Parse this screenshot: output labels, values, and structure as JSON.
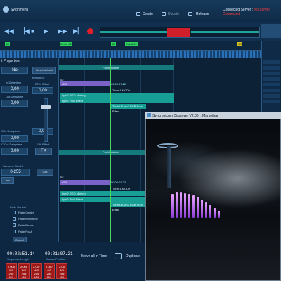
{
  "app": {
    "title": "Sytonmenu"
  },
  "menu": [
    {
      "label": "Create",
      "dim": false
    },
    {
      "label": "Update",
      "dim": true
    },
    {
      "label": "Release",
      "dim": false
    }
  ],
  "status": {
    "prefix": "Connected Server :",
    "value": "No Server Connected"
  },
  "ruler_markers": [
    {
      "label": "1B",
      "color": "green"
    },
    {
      "label": "Detail 22",
      "color": "green"
    },
    {
      "label": "1B",
      "color": "green"
    },
    {
      "label": "Detail 22",
      "color": "green"
    },
    {
      "label": "1B",
      "color": "yellow"
    }
  ],
  "left_panel": {
    "title": "t Properties",
    "no_value": "No",
    "reset_label": "Reset default",
    "fields": [
      {
        "label": "In Delaytime",
        "value": "0,00"
      },
      {
        "label": "Out Delaytime",
        "value": "0,00"
      },
      {
        "label": "C In Delaytime",
        "value": "0,00"
      },
      {
        "label": "C Out Delaytime",
        "value": "0,00"
      }
    ],
    "side_label": "eration ID",
    "bpm_label": "BPM Offset",
    "bpm_value": "0,00",
    "bpm_value2": "0,00",
    "edit_label": "Edit Effect",
    "fx_label": "FX",
    "scene_label": "Scene or Cuelist",
    "range_value": "0-255",
    "call_label": "Call",
    "less_label": "ess",
    "fade_title": "Fade Control",
    "fade_options": [
      "Fade Center",
      "Fade Amplitude",
      "Fade Phase",
      "Fade RyAlt"
    ],
    "cancel_label": "Cancel"
  },
  "timeline": {
    "tracks_a": [
      {
        "kind": "header",
        "label": "Fochfontaine"
      },
      {
        "kind": "label",
        "label": "02"
      },
      {
        "kind": "purple",
        "label": "r255",
        "time": "00:00:07.22"
      },
      {
        "kind": "label",
        "label": "Turm 1 MODe"
      },
      {
        "kind": "teal",
        "label": "Lym2 RGD Moving"
      },
      {
        "kind": "teal",
        "label": "Lym2 Pool Effect"
      },
      {
        "kind": "teal",
        "label": "Turm1&Lym2 RGB Burst Effect"
      }
    ],
    "tracks_b": [
      {
        "kind": "header",
        "label": "Fochfontaine"
      },
      {
        "kind": "label",
        "label": "02"
      },
      {
        "kind": "purple",
        "label": "r255",
        "time": "00:00:07.22"
      },
      {
        "kind": "label",
        "label": "Turm 1 MODe"
      },
      {
        "kind": "teal",
        "label": "Lym2 RGD Moving"
      },
      {
        "kind": "teal",
        "label": "Lym2 Pool Effect"
      },
      {
        "kind": "teal",
        "label": "Turm1&Lym2 RGB Burst Effect"
      }
    ]
  },
  "bottom": {
    "sequence_length": "00:02:51.14",
    "sequence_length_label": "Sequence Length",
    "cursor_position": "00:01:07.21",
    "cursor_position_label": "Cursor Position",
    "move_all_label": "Move all in Time",
    "duplicate_label": "Duplicate",
    "cells": [
      {
        "top": "2.005",
        "mid": "1/C",
        "a": "255",
        "b": "119"
      },
      {
        "top": "2.065",
        "mid": "4/C",
        "a": "255",
        "b": "119"
      },
      {
        "top": "2.057",
        "mid": "4/C",
        "a": "255",
        "b": "119"
      },
      {
        "top": "2.087",
        "mid": "4/C",
        "a": "255",
        "b": "119"
      },
      {
        "top": "2.05",
        "mid": "4/C",
        "a": "255",
        "b": "119"
      }
    ]
  },
  "overlay": {
    "title": "Syncronicum Displayer V2.00 :: Marketbar"
  },
  "colors": {
    "accent": "#49d85f",
    "record": "#e0202a",
    "teal": "#179e95",
    "purple": "#7a62c8"
  }
}
